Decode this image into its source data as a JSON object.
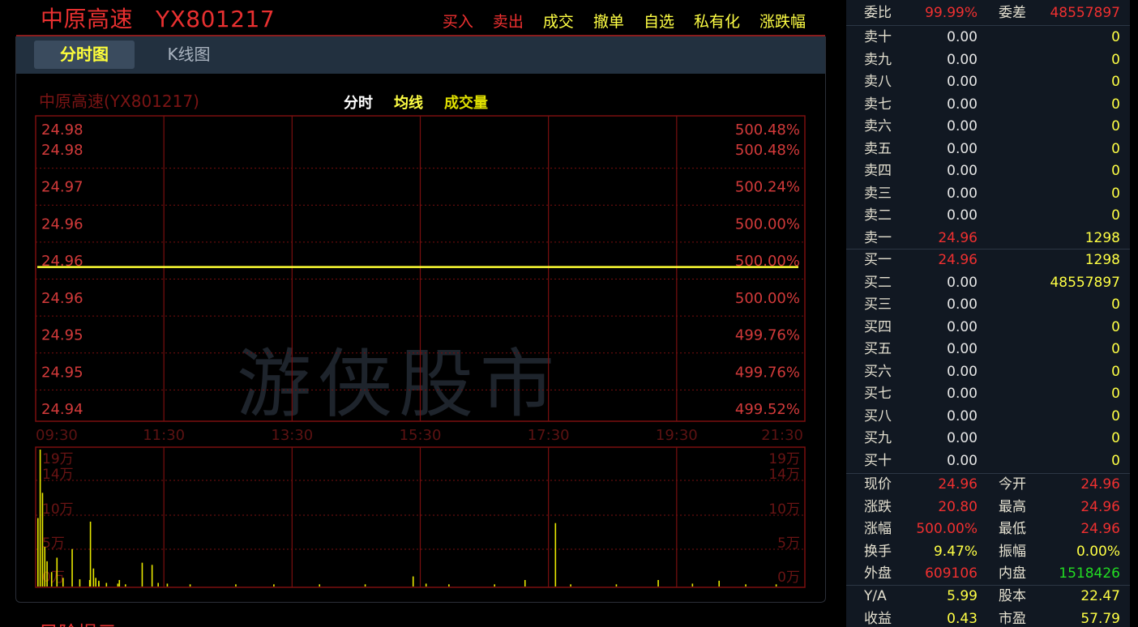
{
  "header": {
    "stock_name": "中原高速",
    "stock_code": "YX801217",
    "nav": [
      {
        "label": "买入",
        "color": "#f03030"
      },
      {
        "label": "卖出",
        "color": "#f03030"
      },
      {
        "label": "成交",
        "color": "#ffff44"
      },
      {
        "label": "撤单",
        "color": "#ffff44"
      },
      {
        "label": "自选",
        "color": "#ffff44"
      },
      {
        "label": "私有化",
        "color": "#ffff44"
      },
      {
        "label": "涨跌幅",
        "color": "#ffff44"
      }
    ]
  },
  "tabs": {
    "active": "分时图",
    "inactive": "K线图"
  },
  "chart": {
    "title": "中原高速(YX801217)",
    "legend": [
      {
        "label": "分时",
        "color": "#ffffff"
      },
      {
        "label": "均线",
        "color": "#ffff44"
      },
      {
        "label": "成交量",
        "color": "#e0e000"
      }
    ],
    "watermark": "游侠股市",
    "colors": {
      "grid": "#7a0f0f",
      "frame": "#7a0f0f",
      "axis_text": "#d23a3a",
      "price_line": "#ffff33",
      "vol_bar": "#e8e800"
    }
  },
  "chart_data": {
    "type": "line",
    "x_ticks": [
      "09:30",
      "11:30",
      "13:30",
      "15:30",
      "17:30",
      "19:30",
      "21:30"
    ],
    "price_labels_left": [
      "24.98",
      "24.98",
      "24.97",
      "24.96",
      "24.96",
      "24.96",
      "24.95",
      "24.95",
      "24.94"
    ],
    "pct_labels_right": [
      "500.48%",
      "500.48%",
      "500.24%",
      "500.00%",
      "500.00%",
      "500.00%",
      "499.76%",
      "499.76%",
      "499.52%"
    ],
    "ylim": [
      24.94,
      24.98
    ],
    "series": [
      {
        "name": "分时",
        "x": [
          "09:30",
          "21:30"
        ],
        "values": [
          24.96,
          24.96
        ]
      }
    ],
    "volume": {
      "ticks": [
        "19万",
        "14万",
        "10万",
        "5万",
        "0万"
      ],
      "ylim": [
        0,
        190000
      ],
      "bars": [
        [
          0.0,
          95000
        ],
        [
          0.003,
          190000
        ],
        [
          0.006,
          130000
        ],
        [
          0.009,
          55000
        ],
        [
          0.012,
          35000
        ],
        [
          0.018,
          20000
        ],
        [
          0.025,
          40000
        ],
        [
          0.033,
          12000
        ],
        [
          0.045,
          52000
        ],
        [
          0.055,
          10000
        ],
        [
          0.068,
          9000
        ],
        [
          0.08,
          6000
        ],
        [
          0.09,
          5000
        ],
        [
          0.105,
          4000
        ],
        [
          0.115,
          3000
        ],
        [
          0.069,
          90000
        ],
        [
          0.073,
          25000
        ],
        [
          0.076,
          12000
        ],
        [
          0.08,
          8000
        ],
        [
          0.107,
          9000
        ],
        [
          0.137,
          33000
        ],
        [
          0.15,
          30000
        ],
        [
          0.158,
          5000
        ],
        [
          0.17,
          4000
        ],
        [
          0.2,
          3000
        ],
        [
          0.26,
          3000
        ],
        [
          0.31,
          3000
        ],
        [
          0.37,
          3000
        ],
        [
          0.43,
          3000
        ],
        [
          0.493,
          14000
        ],
        [
          0.51,
          4000
        ],
        [
          0.54,
          3000
        ],
        [
          0.6,
          3000
        ],
        [
          0.64,
          9000
        ],
        [
          0.68,
          88000
        ],
        [
          0.7,
          3000
        ],
        [
          0.76,
          3000
        ],
        [
          0.815,
          9000
        ],
        [
          0.86,
          4000
        ],
        [
          0.895,
          8000
        ],
        [
          0.93,
          3000
        ],
        [
          0.97,
          3000
        ]
      ]
    }
  },
  "side": {
    "top": [
      {
        "l1": "委比",
        "v1": "99.99%",
        "c1": "#f03030",
        "l2": "委差",
        "v2": "48557897",
        "c2": "#f03030"
      }
    ],
    "sells": [
      {
        "label": "卖十",
        "price": "0.00",
        "price_color": "#e6e6e6",
        "vol": "0"
      },
      {
        "label": "卖九",
        "price": "0.00",
        "price_color": "#e6e6e6",
        "vol": "0"
      },
      {
        "label": "卖八",
        "price": "0.00",
        "price_color": "#e6e6e6",
        "vol": "0"
      },
      {
        "label": "卖七",
        "price": "0.00",
        "price_color": "#e6e6e6",
        "vol": "0"
      },
      {
        "label": "卖六",
        "price": "0.00",
        "price_color": "#e6e6e6",
        "vol": "0"
      },
      {
        "label": "卖五",
        "price": "0.00",
        "price_color": "#e6e6e6",
        "vol": "0"
      },
      {
        "label": "卖四",
        "price": "0.00",
        "price_color": "#e6e6e6",
        "vol": "0"
      },
      {
        "label": "卖三",
        "price": "0.00",
        "price_color": "#e6e6e6",
        "vol": "0"
      },
      {
        "label": "卖二",
        "price": "0.00",
        "price_color": "#e6e6e6",
        "vol": "0"
      },
      {
        "label": "卖一",
        "price": "24.96",
        "price_color": "#f03030",
        "vol": "1298"
      }
    ],
    "buys": [
      {
        "label": "买一",
        "price": "24.96",
        "price_color": "#f03030",
        "vol": "1298"
      },
      {
        "label": "买二",
        "price": "0.00",
        "price_color": "#e6e6e6",
        "vol": "48557897"
      },
      {
        "label": "买三",
        "price": "0.00",
        "price_color": "#e6e6e6",
        "vol": "0"
      },
      {
        "label": "买四",
        "price": "0.00",
        "price_color": "#e6e6e6",
        "vol": "0"
      },
      {
        "label": "买五",
        "price": "0.00",
        "price_color": "#e6e6e6",
        "vol": "0"
      },
      {
        "label": "买六",
        "price": "0.00",
        "price_color": "#e6e6e6",
        "vol": "0"
      },
      {
        "label": "买七",
        "price": "0.00",
        "price_color": "#e6e6e6",
        "vol": "0"
      },
      {
        "label": "买八",
        "price": "0.00",
        "price_color": "#e6e6e6",
        "vol": "0"
      },
      {
        "label": "买九",
        "price": "0.00",
        "price_color": "#e6e6e6",
        "vol": "0"
      },
      {
        "label": "买十",
        "price": "0.00",
        "price_color": "#e6e6e6",
        "vol": "0"
      }
    ],
    "stats": [
      {
        "l1": "现价",
        "v1": "24.96",
        "c1": "#f03030",
        "l2": "今开",
        "v2": "24.96",
        "c2": "#f03030"
      },
      {
        "l1": "涨跌",
        "v1": "20.80",
        "c1": "#f03030",
        "l2": "最高",
        "v2": "24.96",
        "c2": "#f03030"
      },
      {
        "l1": "涨幅",
        "v1": "500.00%",
        "c1": "#f03030",
        "l2": "最低",
        "v2": "24.96",
        "c2": "#f03030"
      },
      {
        "l1": "换手",
        "v1": "9.47%",
        "c1": "#ffff44",
        "l2": "振幅",
        "v2": "0.00%",
        "c2": "#ffff44"
      },
      {
        "l1": "外盘",
        "v1": "609106",
        "c1": "#f03030",
        "l2": "内盘",
        "v2": "1518426",
        "c2": "#22dd22"
      }
    ],
    "stats2": [
      {
        "l1": "Y/A",
        "v1": "5.99",
        "c1": "#ffff44",
        "l2": "股本",
        "v2": "22.47",
        "c2": "#ffff44"
      },
      {
        "l1": "收益",
        "v1": "0.43",
        "c1": "#ffff44",
        "l2": "市盈",
        "v2": "57.79",
        "c2": "#ffff44"
      }
    ]
  },
  "footer": {
    "section_title": "风险提示"
  }
}
